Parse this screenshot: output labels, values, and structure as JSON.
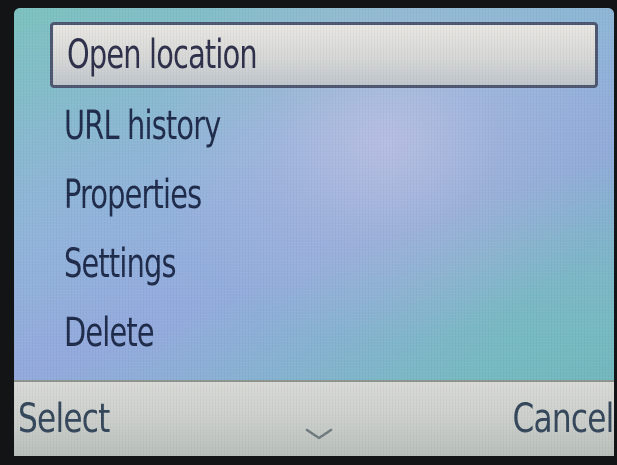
{
  "menu": {
    "items": [
      {
        "label": "Open location",
        "selected": true
      },
      {
        "label": "URL history",
        "selected": false
      },
      {
        "label": "Properties",
        "selected": false
      },
      {
        "label": "Settings",
        "selected": false
      },
      {
        "label": "Delete",
        "selected": false
      }
    ]
  },
  "softkeys": {
    "left_label": "Select",
    "right_label": "Cancel",
    "center_icon": "chevron-down-icon"
  },
  "colors": {
    "selection_border": "#4c5670",
    "text": "#1e2a4a",
    "softkey_text": "#34465a"
  }
}
